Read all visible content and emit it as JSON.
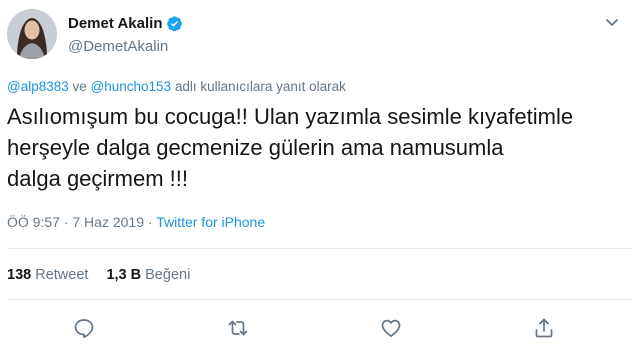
{
  "author": {
    "display_name": "Demet Akalin",
    "handle": "@DemetAkalin"
  },
  "reply_context": {
    "mention1": "@alp8383",
    "connector": " ve ",
    "mention2": "@huncho153",
    "suffix": " adlı kullanıcılara yanıt olarak"
  },
  "tweet": {
    "lines": [
      "Asılıomışum bu cocuga!! Ulan yazımla sesimle kıyafetimle",
      "herşeyle dalga gecmenize gülerin ama namusumla",
      "dalga geçirmem !!!"
    ]
  },
  "meta": {
    "time": "ÖÖ 9:57",
    "separator": " · ",
    "date": "7 Haz 2019",
    "separator2": " · ",
    "source": "Twitter for iPhone"
  },
  "stats": {
    "retweet_count": "138",
    "retweet_label": " Retweet",
    "like_count": "1,3 B",
    "like_label": " Beğeni"
  },
  "icons": {
    "verified": "verified-badge-icon",
    "caret": "chevron-down-icon",
    "reply": "reply-icon",
    "retweet": "retweet-icon",
    "like": "heart-icon",
    "share": "share-icon"
  },
  "colors": {
    "accent": "#1b95e0",
    "muted": "#657786",
    "text": "#14171a",
    "divider": "#e6ecf0"
  }
}
